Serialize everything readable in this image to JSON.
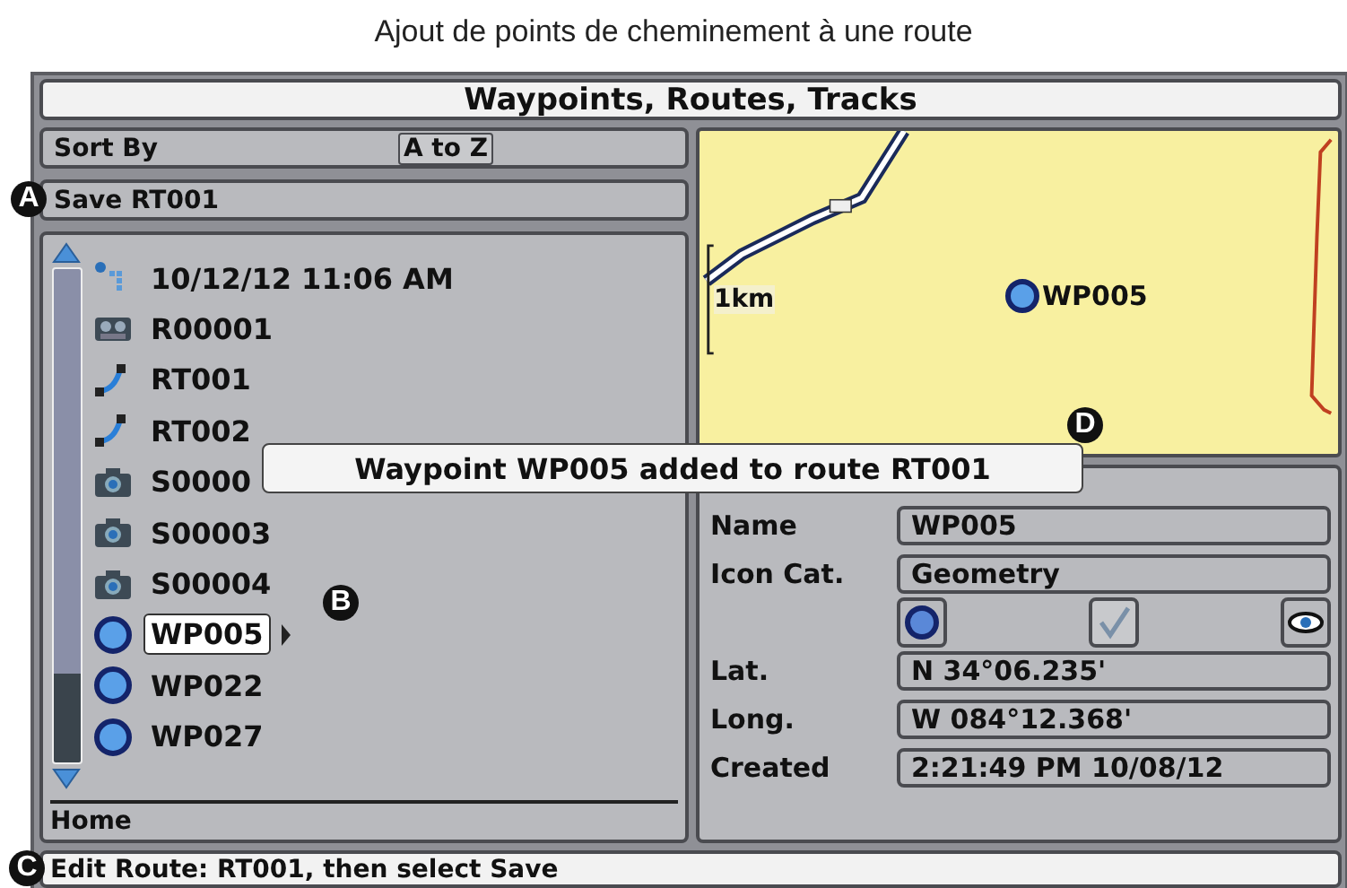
{
  "caption": "Ajout de points de cheminement à une route",
  "window": {
    "title": "Waypoints, Routes, Tracks"
  },
  "sort": {
    "label": "Sort By",
    "value": "A to Z"
  },
  "save_row": {
    "label": "Save RT001",
    "callout": "A"
  },
  "list": {
    "items": [
      {
        "kind": "track",
        "label": "10/12/12 11:06 AM",
        "selected": false
      },
      {
        "kind": "recording",
        "label": "R00001",
        "selected": false
      },
      {
        "kind": "route",
        "label": "RT001",
        "selected": false
      },
      {
        "kind": "route",
        "label": "RT002",
        "selected": false
      },
      {
        "kind": "snapshot",
        "label": "S0000",
        "selected": false
      },
      {
        "kind": "snapshot",
        "label": "S00003",
        "selected": false
      },
      {
        "kind": "snapshot",
        "label": "S00004",
        "selected": false
      },
      {
        "kind": "waypoint",
        "label": "WP005",
        "selected": true,
        "callout": "B"
      },
      {
        "kind": "waypoint",
        "label": "WP022",
        "selected": false
      },
      {
        "kind": "waypoint",
        "label": "WP027",
        "selected": false
      }
    ],
    "footer": "Home"
  },
  "map": {
    "kind": "picture",
    "scale": "1km",
    "waypoint": "WP005"
  },
  "details": {
    "fields": [
      {
        "label": "Name",
        "value": "WP005"
      },
      {
        "label": "Icon Cat.",
        "value": "Geometry"
      },
      {
        "kind": "icons",
        "visible": true
      },
      {
        "label": "Lat.",
        "value": "N 34°06.235'"
      },
      {
        "label": "Long.",
        "value": "W 084°12.368'"
      },
      {
        "label": "Created",
        "value": "2:21:49 PM 10/08/12"
      }
    ]
  },
  "toast": {
    "text": "Waypoint WP005 added to route RT001",
    "callout": "D"
  },
  "status_bar": {
    "text": "Edit Route: RT001, then select Save",
    "callout": "C"
  }
}
